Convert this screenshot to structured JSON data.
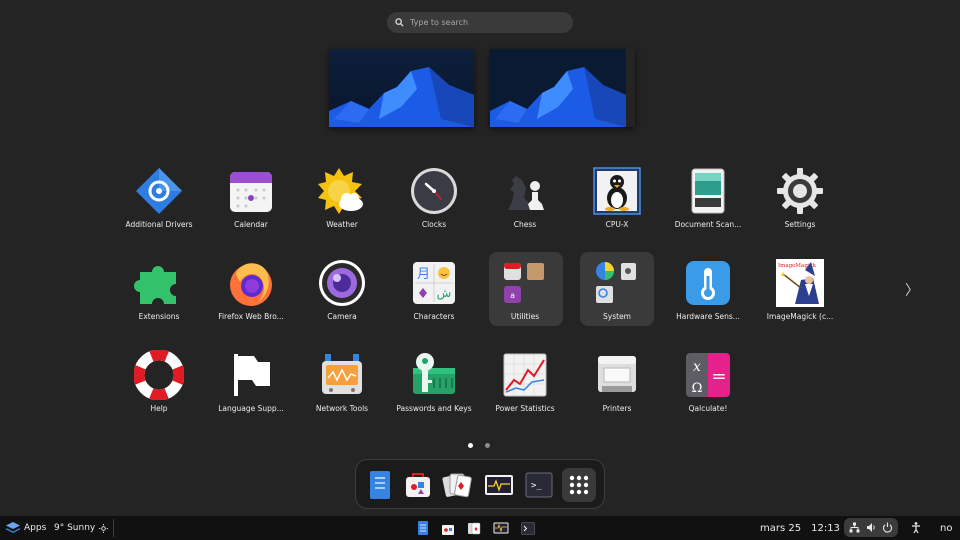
{
  "search": {
    "placeholder": "Type to search"
  },
  "apps": [
    {
      "label": "Additional Drivers",
      "icon": "additional-drivers-icon"
    },
    {
      "label": "Calendar",
      "icon": "calendar-icon"
    },
    {
      "label": "Weather",
      "icon": "weather-icon"
    },
    {
      "label": "Clocks",
      "icon": "clock-icon"
    },
    {
      "label": "Chess",
      "icon": "chess-icon"
    },
    {
      "label": "CPU-X",
      "icon": "cpu-x-icon"
    },
    {
      "label": "Document Scan...",
      "icon": "document-scanner-icon"
    },
    {
      "label": "Settings",
      "icon": "gear-icon"
    },
    {
      "label": "Extensions",
      "icon": "puzzle-icon"
    },
    {
      "label": "Firefox Web Bro...",
      "icon": "firefox-icon"
    },
    {
      "label": "Camera",
      "icon": "camera-icon"
    },
    {
      "label": "Characters",
      "icon": "characters-icon"
    },
    {
      "label": "Utilities",
      "icon": "utilities-folder-icon"
    },
    {
      "label": "System",
      "icon": "system-folder-icon"
    },
    {
      "label": "Hardware Sens...",
      "icon": "thermometer-icon"
    },
    {
      "label": "ImageMagick (c...",
      "icon": "imagemagick-icon"
    },
    {
      "label": "Help",
      "icon": "lifebuoy-icon"
    },
    {
      "label": "Language Supp...",
      "icon": "flag-icon"
    },
    {
      "label": "Network Tools",
      "icon": "network-tools-icon"
    },
    {
      "label": "Passwords and Keys",
      "icon": "key-icon"
    },
    {
      "label": "Power Statistics",
      "icon": "power-statistics-icon"
    },
    {
      "label": "Printers",
      "icon": "printer-icon"
    },
    {
      "label": "Qalculate!",
      "icon": "calculator-icon"
    }
  ],
  "characters_icon": {
    "a": "月",
    "b": "ش"
  },
  "imagemagick_icon": {
    "text": "ImageMagick"
  },
  "qalculate_icon": {
    "x": "x",
    "omega": "Ω",
    "eq": "="
  },
  "pager": {
    "pages": 2,
    "current": 1
  },
  "next_arrow": "〉",
  "dock": {
    "items": [
      "text-editor-icon",
      "software-icon",
      "card-game-icon",
      "system-monitor-icon",
      "terminal-icon",
      "app-grid-icon"
    ]
  },
  "taskbar": {
    "apps_label": "Apps",
    "weather": "9°  Sunny",
    "date": "mars 25",
    "time": "12:13",
    "lang": "no",
    "terminal_prompt": ">_"
  },
  "colors": {
    "background": "#242424",
    "panel": "#111111",
    "accent": "#3584e4"
  }
}
